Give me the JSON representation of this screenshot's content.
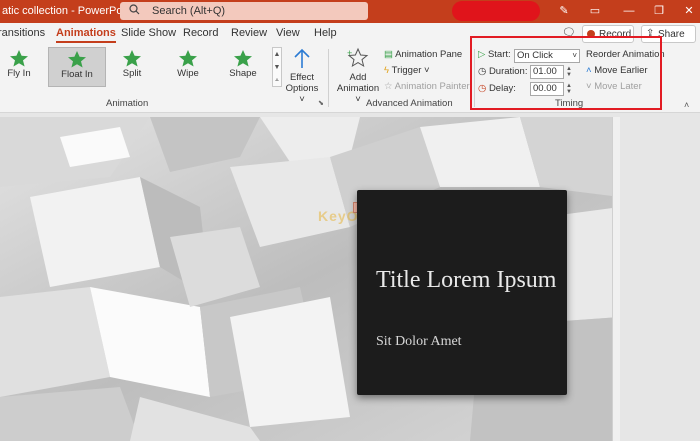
{
  "titlebar": {
    "doc_title": "atic collection  -  PowerPoint",
    "search_placeholder": "Search (Alt+Q)"
  },
  "tabs": {
    "items": [
      "ransitions",
      "Animations",
      "Slide Show",
      "Record",
      "Review",
      "View",
      "Help"
    ],
    "active": "Animations",
    "record_label": "Record",
    "share_label": "Share"
  },
  "ribbon": {
    "animation_group": {
      "items": [
        {
          "label": "Fly In",
          "selected": false
        },
        {
          "label": "Float In",
          "selected": true
        },
        {
          "label": "Split",
          "selected": false
        },
        {
          "label": "Wipe",
          "selected": false
        },
        {
          "label": "Shape",
          "selected": false
        }
      ],
      "effect_options_label1": "Effect",
      "effect_options_label2": "Options",
      "group_label": "Animation"
    },
    "advanced_group": {
      "add_animation_label1": "Add",
      "add_animation_label2": "Animation",
      "animation_pane": "Animation Pane",
      "trigger": "Trigger",
      "animation_painter": "Animation Painter",
      "group_label": "Advanced Animation"
    },
    "timing_group": {
      "start_label": "Start:",
      "start_value": "On Click",
      "duration_label": "Duration:",
      "duration_value": "01.00",
      "delay_label": "Delay:",
      "delay_value": "00.00",
      "reorder_label": "Reorder Animation",
      "move_earlier": "Move Earlier",
      "move_later": "Move Later",
      "group_label": "Timing"
    }
  },
  "slide": {
    "animation_tag": "2",
    "title": "Title Lorem Ipsum",
    "subtitle": "Sit Dolor Amet",
    "watermark": "KeyOff"
  },
  "colors": {
    "accent": "#c43e1c",
    "highlight_box": "#e21b23",
    "star_green": "#3aa14a"
  }
}
